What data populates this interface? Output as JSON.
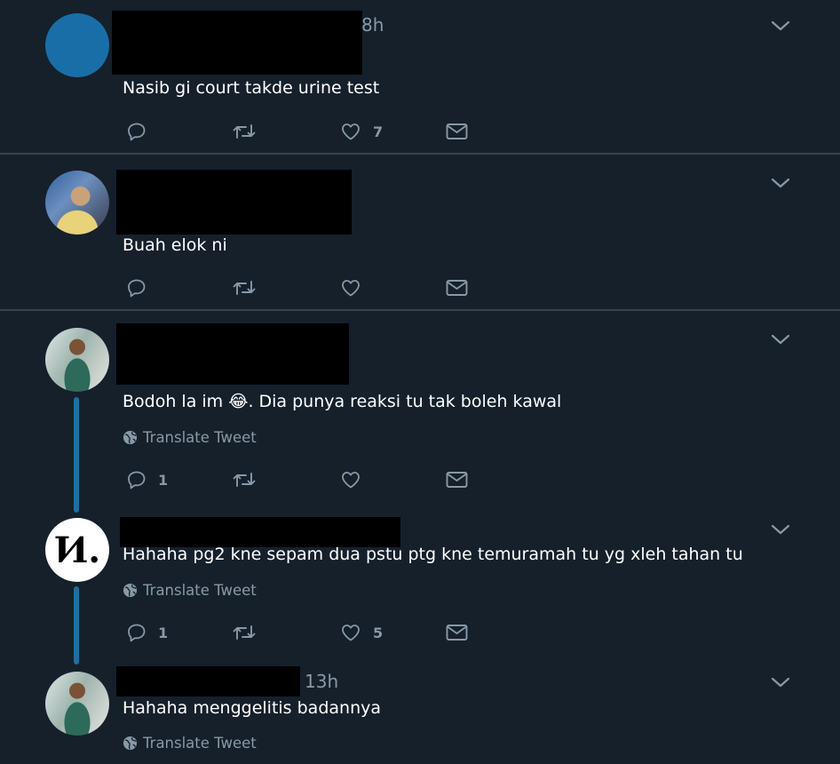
{
  "theme": {
    "background": "#15202b",
    "icon_color": "#8899a6",
    "thread_line": "#1d6fa5",
    "separator": "#38444d"
  },
  "tweets": [
    {
      "time": "8h",
      "text": "Nasib gi court takde urine test",
      "replies": "",
      "likes": "7"
    },
    {
      "time": "",
      "text": "Buah elok ni",
      "replies": "",
      "likes": ""
    },
    {
      "time": "",
      "text_before": "Bodoh la im",
      "emoji": "😂",
      "text_after": ". Dia punya reaksi tu tak boleh kawal",
      "translate": "Translate Tweet",
      "replies": "1",
      "likes": ""
    },
    {
      "time": "",
      "avatar_logo": "Ͷ.",
      "text": "Hahaha pg2 kne sepam dua pstu ptg kne temuramah tu yg xleh tahan tu",
      "translate": "Translate Tweet",
      "replies": "1",
      "likes": "5"
    },
    {
      "time": "13h",
      "text": "Hahaha menggelitis badannya",
      "translate": "Translate Tweet"
    }
  ],
  "icons": [
    "reply-icon",
    "retweet-icon",
    "like-icon",
    "message-icon",
    "chevron-down-icon",
    "globe-icon"
  ]
}
